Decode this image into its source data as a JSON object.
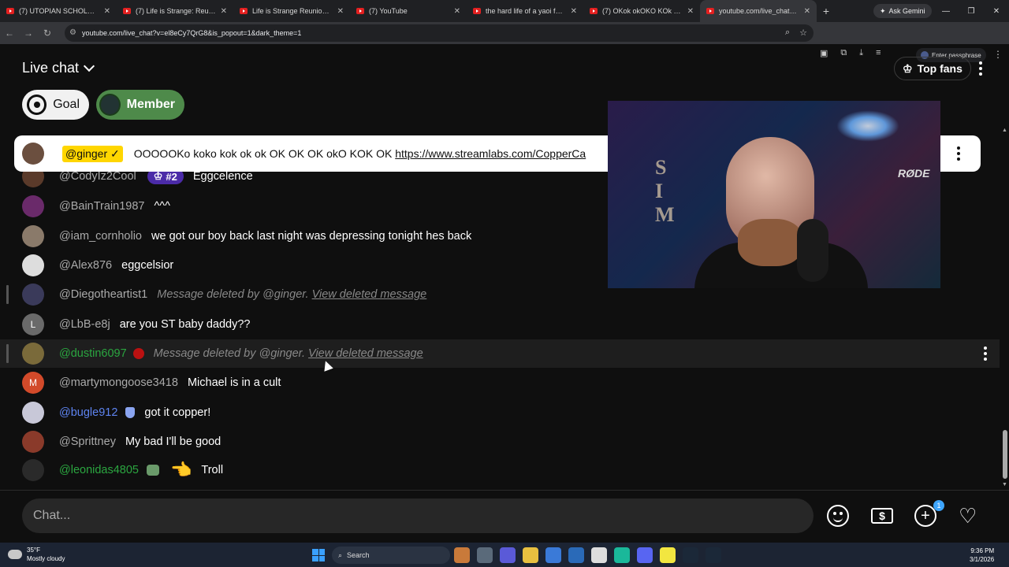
{
  "browser": {
    "tabs": [
      {
        "title": "(7) UTOPIAN SCHOLASTIC",
        "active": false
      },
      {
        "title": "(7) Life is Strange: Reunion -",
        "active": false
      },
      {
        "title": "Life is Strange Reunion Exclu",
        "active": false
      },
      {
        "title": "(7) YouTube",
        "active": false
      },
      {
        "title": "the hard life of a yaoi fangirl",
        "active": false
      },
      {
        "title": "(7) OKok okOKO KOk ok oK",
        "active": false
      },
      {
        "title": "youtube.com/live_chat?v=el",
        "active": true
      }
    ],
    "ask_gemini": "Ask Gemini",
    "url": "youtube.com/live_chat?v=el8eCy7QrG8&is_popout=1&dark_theme=1",
    "passphrase": "Enter passphrase"
  },
  "chat": {
    "title": "Live chat",
    "top_fans": "Top fans",
    "goal_label": "Goal",
    "member_label": "Member",
    "pinned": {
      "author": "@ginger",
      "text": "OOOOOKo koko kok ok ok OK OK OK okO KOK OK",
      "link": "https://www.streamlabs.com/CopperCa"
    },
    "messages": [
      {
        "author": "@CodyIz2Cool",
        "rank": "#2",
        "text": "Eggcelence",
        "avatar_color": "#5a3a2a"
      },
      {
        "author": "@BainTrain1987",
        "text": "^^^",
        "avatar_color": "#6a2a6a"
      },
      {
        "author": "@iam_cornholio",
        "text": "we got our boy back last night was depressing tonight hes back",
        "avatar_color": "#8a7a6a"
      },
      {
        "author": "@Alex876",
        "text": "eggcelsior",
        "avatar_color": "#dddddd"
      },
      {
        "author": "@Diegotheartist1",
        "deleted": "Message deleted by @ginger.",
        "view": "View deleted message",
        "avatar_color": "#3a3a5a"
      },
      {
        "author": "@LbB-e8j",
        "text": "are you ST baby daddy??",
        "avatar_color": "#6a6a6a",
        "initial": "L"
      },
      {
        "author": "@dustin6097",
        "deleted": "Message deleted by @ginger.",
        "view": "View deleted message",
        "avatar_color": "#7a6a3a"
      },
      {
        "author": "@martymongoose3418",
        "text": "Michael is in a cult",
        "avatar_color": "#d24a2a",
        "initial": "M"
      },
      {
        "author": "@bugle912",
        "text": "got it copper!",
        "avatar_color": "#c8c8d8"
      },
      {
        "author": "@Sprittney",
        "text": "My bad I'll be good",
        "avatar_color": "#8a3a2a"
      },
      {
        "author": "@leonidas4805",
        "emoji": "👈",
        "text": "Troll",
        "avatar_color": "#2a2a2a"
      }
    ],
    "input_placeholder": "Chat...",
    "notification_count": "1"
  },
  "video": {
    "mic_brand": "RØDE",
    "sign_letters": "S\nI\nM"
  },
  "taskbar": {
    "temperature": "35°F",
    "weather": "Mostly cloudy",
    "search": "Search",
    "time": "9:36 PM",
    "date": "3/1/2026"
  }
}
